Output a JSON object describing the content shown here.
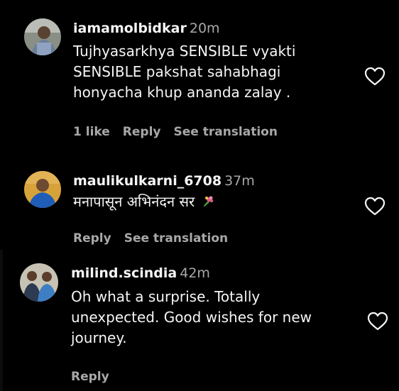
{
  "comments": [
    {
      "username": "iamamolbidkar",
      "time": "20m",
      "text_lines": [
        "Tujhyasarkhya SENSIBLE vyakti",
        "SENSIBLE pakshat sahabhagi",
        "honyacha khup ananda zalay ."
      ],
      "likes": "1 like",
      "reply": "Reply",
      "translate": "See translation",
      "avatar_icon": "user-avatar-icon"
    },
    {
      "username": "maulikulkarni_6708",
      "time": "37m",
      "text_lines": [
        "मनापासून अभिनंदन सर"
      ],
      "emoji": "bouquet-emoji",
      "reply": "Reply",
      "translate": "See translation",
      "avatar_icon": "user-avatar-icon"
    },
    {
      "username": "milind.scindia",
      "time": "42m",
      "text_lines": [
        "Oh what a surprise. Totally",
        "unexpected. Good wishes for new",
        "journey."
      ],
      "reply": "Reply",
      "avatar_icon": "user-avatar-icon"
    }
  ],
  "colors": {
    "background": "#000000",
    "primary_text": "#f5f5f5",
    "secondary_text": "#a8a8a8"
  }
}
